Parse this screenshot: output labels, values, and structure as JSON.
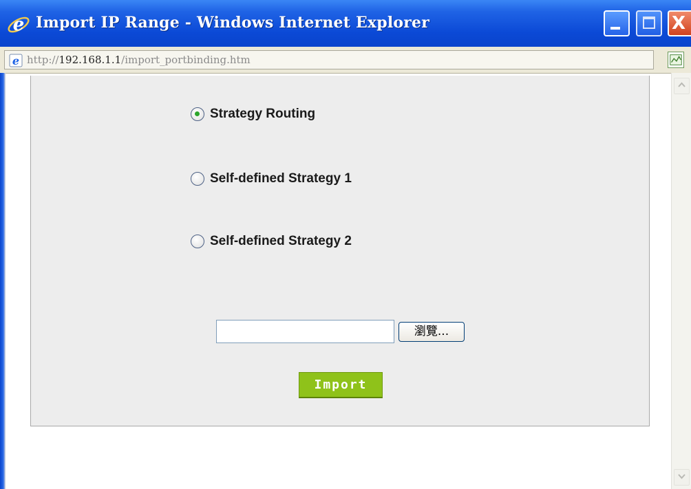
{
  "window": {
    "title": "Import IP Range - Windows Internet Explorer",
    "minimize_icon": "minimize-icon",
    "maximize_icon": "maximize-icon",
    "close_glyph": "X"
  },
  "address": {
    "url_prefix": "http://",
    "url_host": "192.168.1.1",
    "url_path": "/import_portbinding.htm"
  },
  "form": {
    "options": [
      {
        "label": "Strategy Routing",
        "checked": true
      },
      {
        "label": "Self-defined Strategy 1",
        "checked": false
      },
      {
        "label": "Self-defined Strategy 2",
        "checked": false
      }
    ],
    "file_value": "",
    "browse_label": "瀏覽...",
    "import_label": "Import"
  },
  "colors": {
    "titlebar": "#0b49d6",
    "import_button": "#8fc21a",
    "panel": "#ededed"
  }
}
